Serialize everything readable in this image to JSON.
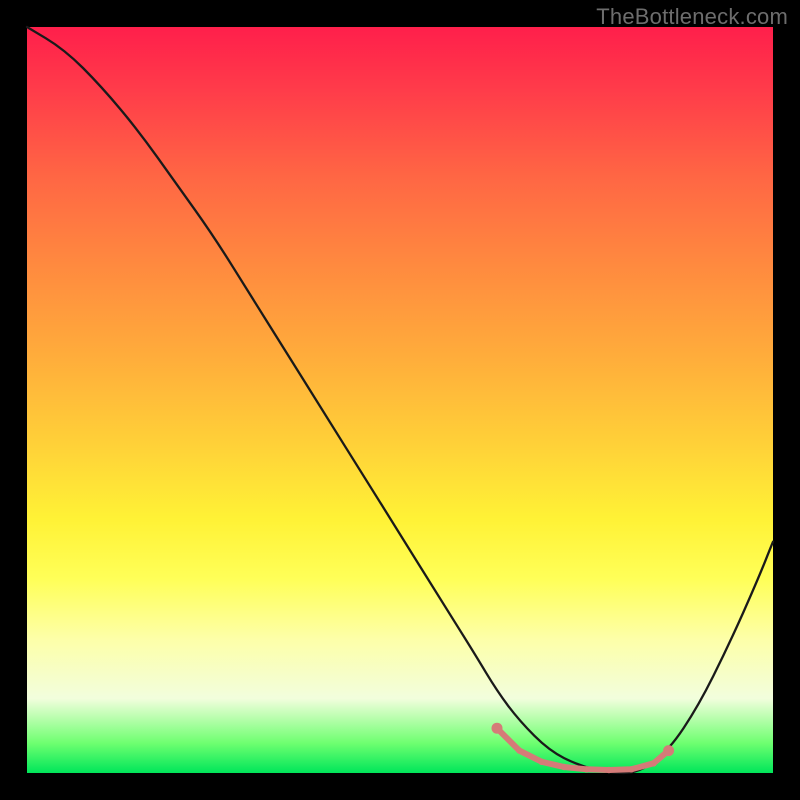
{
  "watermark": "TheBottleneck.com",
  "colors": {
    "background": "#000000",
    "curve": "#1a1a1a",
    "markers": "#d57b78",
    "gradient_top": "#ff1f4b",
    "gradient_bottom": "#00e65a"
  },
  "chart_data": {
    "type": "line",
    "title": "",
    "xlabel": "",
    "ylabel": "",
    "xlim": [
      0,
      100
    ],
    "ylim": [
      0,
      100
    ],
    "note": "Axes are unlabeled in the source image; x and y values are estimated positions in percent of plot area, with y=0 at the bottom (green) and y=100 at the top (red). The curve descends steeply from upper-left, reaches ~0 around x≈70–82, then rises toward the right edge.",
    "series": [
      {
        "name": "bottleneck-curve",
        "x": [
          0,
          5,
          10,
          15,
          20,
          25,
          30,
          35,
          40,
          45,
          50,
          55,
          60,
          63,
          66,
          70,
          74,
          78,
          82,
          86,
          90,
          94,
          98,
          100
        ],
        "y": [
          100,
          97,
          92,
          86,
          79,
          72,
          64,
          56,
          48,
          40,
          32,
          24,
          16,
          11,
          7,
          3,
          1,
          0,
          0,
          3,
          9,
          17,
          26,
          31
        ]
      }
    ],
    "markers": {
      "name": "highlight-band",
      "x": [
        63,
        66,
        69,
        72,
        75,
        78,
        81,
        84,
        86
      ],
      "y": [
        6,
        3,
        1.5,
        0.8,
        0.5,
        0.4,
        0.5,
        1.3,
        3
      ]
    }
  }
}
